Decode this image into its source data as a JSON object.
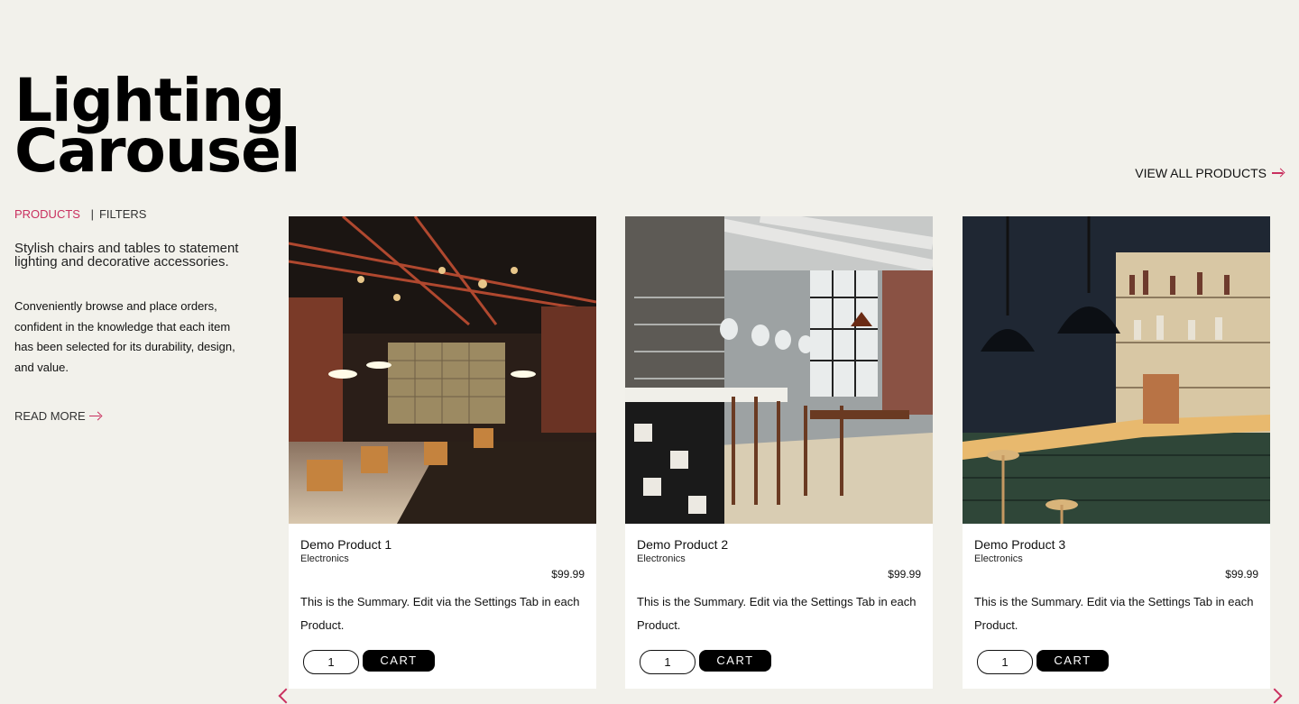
{
  "page": {
    "title_line1": "Lighting",
    "title_line2": "Carousel",
    "view_all": "VIEW ALL PRODUCTS"
  },
  "breadcrumbs": {
    "products": "PRODUCTS",
    "separator": "|",
    "filters": "FILTERS"
  },
  "intro": {
    "tagline": "Stylish chairs and tables to statement lighting and decorative accessories.",
    "description": "Conveniently browse and place orders, confident in the knowledge that each item has been selected for its durability, design, and value.",
    "read_more": "READ MORE"
  },
  "accent_color": "#c9305f",
  "products": [
    {
      "name": "Demo Product 1",
      "category": "Electronics",
      "price": "$99.99",
      "summary": "This is the Summary. Edit via the Settings Tab in each Product.",
      "qty": "1",
      "cart_label": "CART"
    },
    {
      "name": "Demo Product 2",
      "category": "Electronics",
      "price": "$99.99",
      "summary": "This is the Summary. Edit via the Settings Tab in each Product.",
      "qty": "1",
      "cart_label": "CART"
    },
    {
      "name": "Demo Product 3",
      "category": "Electronics",
      "price": "$99.99",
      "summary": "This is the Summary. Edit via the Settings Tab in each Product.",
      "qty": "1",
      "cart_label": "CART"
    }
  ]
}
